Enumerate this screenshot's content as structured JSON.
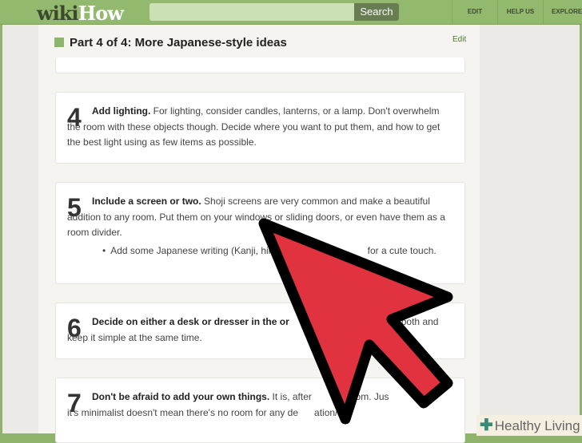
{
  "header": {
    "logo_wiki": "wiki",
    "logo_how": "How",
    "search_label": "Search",
    "nav": [
      "EDIT",
      "HELP US",
      "EXPLORE"
    ]
  },
  "section": {
    "title": "Part 4 of 4: More Japanese-style ideas",
    "edit_label": "Edit"
  },
  "steps": [
    {
      "num": "4",
      "bold": "Add lighting.",
      "text": " For lighting, consider candles, lanterns, or a lamp. Don't overwhelm the room with these objects though. Decide where you want to put them, and how to get the best light using as few items as possible."
    },
    {
      "num": "5",
      "bold": "Include a screen or two.",
      "text": " Shoji screens are very common and make a beautiful addition to any room. Put them on your windows or sliding doors, or even have them as a room divider.",
      "bullet": "Add some Japanese writing (Kanji, hira",
      "bullet_end": "for a cute touch."
    },
    {
      "num": "6",
      "bold": "Decide on either a desk or dresser in the or",
      "text_end": "both and",
      "text2": "keep it simple at the same time."
    },
    {
      "num": "7",
      "bold": "Don't be afraid to add your own things.",
      "text": " It is, after",
      "text_end": "ur room. Jus",
      "text2": "it's minimalist doesn't mean there's no room for any de",
      "text2_end": "ation/"
    }
  ],
  "badge": {
    "label": "Healthy Living"
  },
  "colors": {
    "brand": "#93b96e",
    "cursor": "#e0323f"
  }
}
